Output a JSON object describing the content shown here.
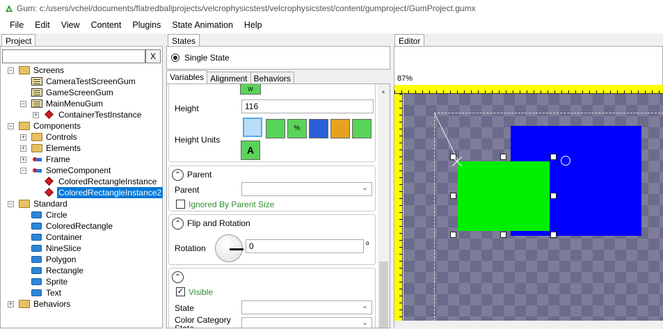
{
  "window": {
    "title": "Gum: c:/users/vchel/documents/flatredballprojects/velcrophysicstest/velcrophysicstest/content/gumproject/GumProject.gumx"
  },
  "menu": [
    "File",
    "Edit",
    "View",
    "Content",
    "Plugins",
    "State Animation",
    "Help"
  ],
  "project": {
    "tab": "Project",
    "search_value": "",
    "clear_label": "X",
    "tree": [
      {
        "label": "Screens",
        "icon": "folder-icon",
        "level": 0,
        "exp": "−"
      },
      {
        "label": "CameraTestScreenGum",
        "icon": "screen-icon",
        "level": 1,
        "exp": ""
      },
      {
        "label": "GameScreenGum",
        "icon": "screen-icon",
        "level": 1,
        "exp": ""
      },
      {
        "label": "MainMenuGum",
        "icon": "screen-icon",
        "level": 1,
        "exp": "−"
      },
      {
        "label": "ContainerTestInstance",
        "icon": "instance-icon",
        "level": 2,
        "exp": "+"
      },
      {
        "label": "Components",
        "icon": "folder-icon",
        "level": 0,
        "exp": "−"
      },
      {
        "label": "Controls",
        "icon": "folder-icon",
        "level": 1,
        "exp": "+"
      },
      {
        "label": "Elements",
        "icon": "folder-icon",
        "level": 1,
        "exp": "+"
      },
      {
        "label": "Frame",
        "icon": "component-icon",
        "level": 1,
        "exp": "+"
      },
      {
        "label": "SomeComponent",
        "icon": "component-icon",
        "level": 1,
        "exp": "−"
      },
      {
        "label": "ColoredRectangleInstance",
        "icon": "instance-icon",
        "level": 2,
        "exp": ""
      },
      {
        "label": "ColoredRectangleInstance2",
        "icon": "instance-icon",
        "level": 2,
        "exp": "",
        "selected": true
      },
      {
        "label": "Standard",
        "icon": "folder-icon",
        "level": 0,
        "exp": "−"
      },
      {
        "label": "Circle",
        "icon": "standard-icon",
        "level": 1,
        "exp": ""
      },
      {
        "label": "ColoredRectangle",
        "icon": "standard-icon",
        "level": 1,
        "exp": ""
      },
      {
        "label": "Container",
        "icon": "standard-icon",
        "level": 1,
        "exp": ""
      },
      {
        "label": "NineSlice",
        "icon": "standard-icon",
        "level": 1,
        "exp": ""
      },
      {
        "label": "Polygon",
        "icon": "standard-icon",
        "level": 1,
        "exp": ""
      },
      {
        "label": "Rectangle",
        "icon": "standard-icon",
        "level": 1,
        "exp": ""
      },
      {
        "label": "Sprite",
        "icon": "standard-icon",
        "level": 1,
        "exp": ""
      },
      {
        "label": "Text",
        "icon": "standard-icon",
        "level": 1,
        "exp": ""
      },
      {
        "label": "Behaviors",
        "icon": "folder-icon",
        "level": 0,
        "exp": "+"
      }
    ]
  },
  "states": {
    "tab": "States",
    "single_state": "Single State"
  },
  "tabs": [
    "Variables",
    "Alignment",
    "Behaviors"
  ],
  "variables": {
    "height_label": "Height",
    "height_value": "116",
    "height_units_label": "Height Units",
    "parent_section": "Parent",
    "parent_label": "Parent",
    "parent_value": "",
    "ignored_by_parent_size": "Ignored By Parent Size",
    "flip_section": "Flip and Rotation",
    "rotation_label": "Rotation",
    "rotation_value": "0",
    "rotation_unit": "º",
    "visible_label": "Visible",
    "state_label": "State",
    "color_category_label": "Color Category State"
  },
  "editor": {
    "tab": "Editor",
    "zoom": "87%"
  },
  "colors": {
    "selection": "#0078d7",
    "blue_rect": "#0000ff",
    "green_rect": "#00ee00",
    "ruler": "#ffff00"
  }
}
